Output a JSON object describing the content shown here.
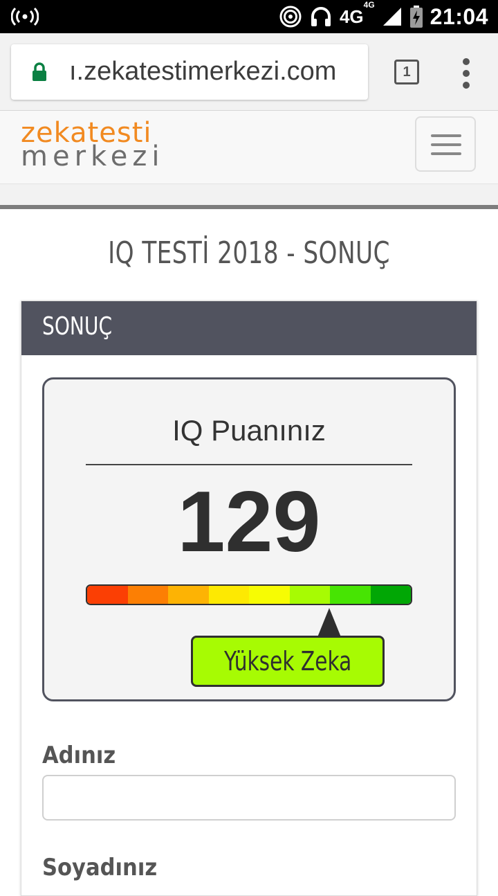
{
  "status_bar": {
    "network": "4G",
    "network_small": "4G",
    "time": "21:04"
  },
  "browser": {
    "url": "ı.zekatestimerkezi.com",
    "tab_count": "1"
  },
  "site": {
    "logo_line1": "zekatesti",
    "logo_line2": "merkezi"
  },
  "page": {
    "title": "IQ TESTİ 2018 - SONUÇ"
  },
  "panel": {
    "heading": "SONUÇ",
    "result_label": "IQ Puanınız",
    "score": "129",
    "scale_position": 0.745,
    "scale_colors": [
      "#fb3f04",
      "#fc7f04",
      "#fdb304",
      "#fde902",
      "#f7fc03",
      "#a7fb03",
      "#47e403",
      "#01a705"
    ],
    "level": "Yüksek Zeka"
  },
  "form": {
    "first_name_label": "Adınız",
    "first_name_value": "",
    "last_name_label": "Soyadınız"
  }
}
